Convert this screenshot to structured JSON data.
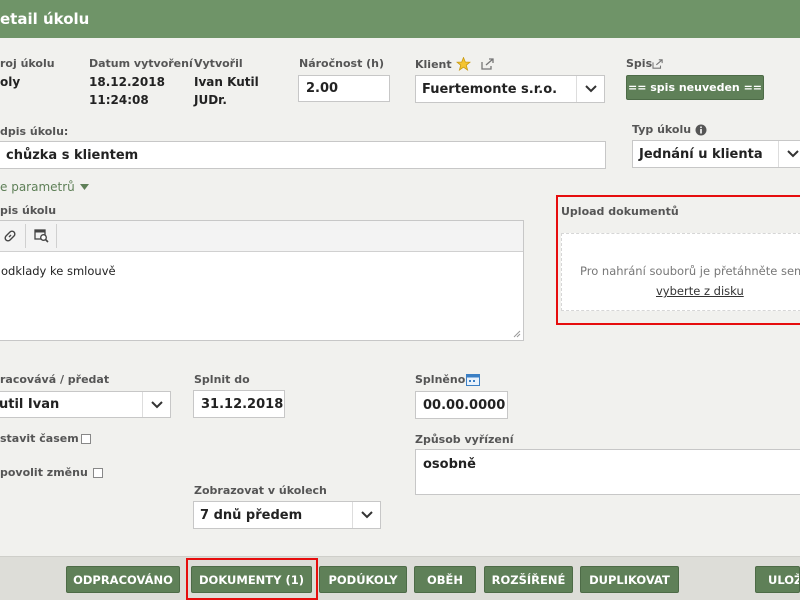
{
  "window": {
    "title": "etail úkolu"
  },
  "header_fields": {
    "source": {
      "label": "roj úkolu",
      "value": "oly"
    },
    "created": {
      "label": "Datum vytvoření",
      "date": "18.12.2018",
      "time": "11:24:08"
    },
    "author": {
      "label": "Vytvořil",
      "line1": "Ivan Kutil",
      "line2": "JUDr."
    },
    "effort": {
      "label": "Náročnost (h)",
      "value": "2.00"
    },
    "client": {
      "label": "Klient",
      "value": "Fuertemonte s.r.o."
    },
    "spis": {
      "label": "Spis",
      "button": "== spis neuveden =="
    }
  },
  "subject": {
    "label": "dpis úkolu:",
    "value": "chůzka s klientem"
  },
  "task_type": {
    "label": "Typ úkolu",
    "value": "Jednání u klienta"
  },
  "params_link": "e parametrů",
  "description": {
    "label": "pis úkolu",
    "text": "odklady ke smlouvě"
  },
  "upload": {
    "title": "Upload dokumentů",
    "hint": "Pro nahrání souborů je přetáhněte sem neb",
    "link": "vyberte z disku"
  },
  "assignee": {
    "label": "racovává / předat",
    "value": "util Ivan"
  },
  "deadline": {
    "label": "Splnit do",
    "value": "31.12.2018"
  },
  "done": {
    "label": "Splněno",
    "value": "00.00.0000"
  },
  "options": {
    "timer": "stavit časem",
    "allow_change": "povolit změnu"
  },
  "resolution": {
    "label": "Způsob vyřízení",
    "value": "osobně"
  },
  "show_in": {
    "label": "Zobrazovat v úkolech",
    "value": "7 dnů předem"
  },
  "buttons": {
    "done": "ODPRACOVÁNO",
    "documents": "DOKUMENTY (1)",
    "subtasks": "PODÚKOLY",
    "flow": "OBĚH",
    "extended": "ROZŠÍŘENÉ",
    "duplicate": "DUPLIKOVAT",
    "save": "ULOŽ"
  },
  "colors": {
    "brand": "#6f9468",
    "button": "#5f8058",
    "highlight": "#e60d0d"
  }
}
